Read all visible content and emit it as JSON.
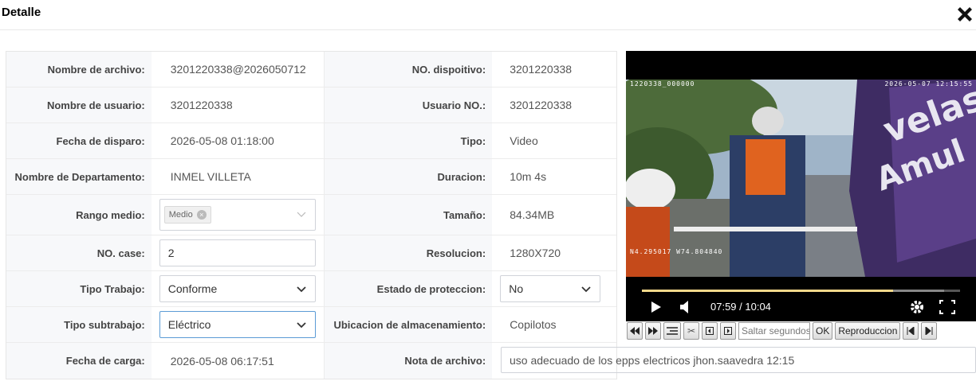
{
  "dialog": {
    "title": "Detalle"
  },
  "rows": [
    {
      "label1": "Nombre de archivo:",
      "value1": "3201220338@2026050712",
      "label2": "NO. dispoitivo:",
      "value2": "3201220338"
    },
    {
      "label1": "Nombre de usuario:",
      "value1": "3201220338",
      "label2": "Usuario NO.:",
      "value2": "3201220338"
    },
    {
      "label1": "Fecha de disparo:",
      "value1": "2026-05-08 01:18:00",
      "label2": "Tipo:",
      "value2": "Video"
    },
    {
      "label1": "Nombre de Departamento:",
      "value1": "INMEL VILLETA",
      "label2": "Duracion:",
      "value2": "10m 4s"
    },
    {
      "label1": "Rango medio:",
      "value1": "Medio",
      "label2": "Tamaño:",
      "value2": "84.34MB"
    },
    {
      "label1": "NO. case:",
      "value1": "2",
      "label2": "Resolucion:",
      "value2": "1280X720"
    },
    {
      "label1": "Tipo Trabajo:",
      "value1": "Conforme",
      "label2": "Estado de proteccion:",
      "value2": "No"
    },
    {
      "label1": "Tipo subtrabajo:",
      "value1": "Eléctrico",
      "label2": "Ubicacion de almacenamiento:",
      "value2": "Copilotos"
    },
    {
      "label1": "Fecha de carga:",
      "value1": "2026-05-08 06:17:51",
      "label2": "Nota de archivo:",
      "value2": "uso adecuado de los epps electricos jhon.saavedra 12:15"
    }
  ],
  "player": {
    "osd_id": "1220338_000000",
    "osd_datetime": "2026-05-07 12:15:55",
    "osd_gps": "N4.295017 W74.804840",
    "time": "07:59 / 10:04",
    "progress": 0.79,
    "buffered": 0.95
  },
  "toolbar": {
    "seek_placeholder": "Saltar segundos",
    "ok_label": "OK",
    "playback_label": "Reproduccion"
  },
  "colors": {
    "accent_focus": "#5b9bd5",
    "label_bg": "#f7f8fa"
  }
}
